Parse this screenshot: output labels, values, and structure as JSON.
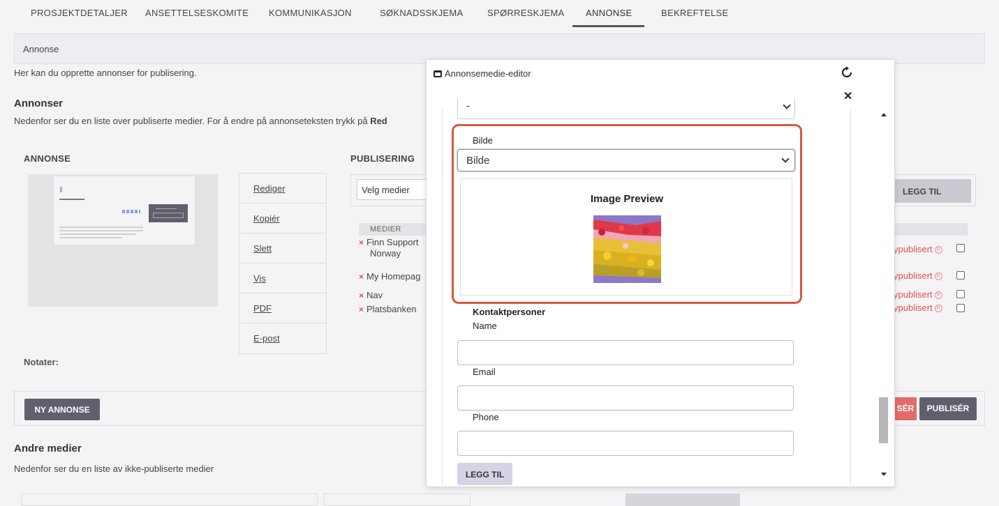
{
  "tabs": [
    {
      "label": "PROSJEKTDETALJER"
    },
    {
      "label": "ANSETTELSESKOMITE"
    },
    {
      "label": "KOMMUNIKASJON"
    },
    {
      "label": "SØKNADSSKJEMA"
    },
    {
      "label": "SPØRRESKJEMA"
    },
    {
      "label": "ANNONSE"
    },
    {
      "label": "BEKREFTELSE"
    }
  ],
  "section": {
    "title": "Annonse",
    "description": "Her kan du opprette annonser for publisering."
  },
  "ads": {
    "heading": "Annonser",
    "description": "Nedenfor ser du en liste over publiserte medier. For å endre på annonseteksten trykk på",
    "description_bold": "Red"
  },
  "annonse_label": "ANNONSE",
  "publisering_label": "PUBLISERING",
  "actions": [
    {
      "label": "Rediger"
    },
    {
      "label": "Kopiér"
    },
    {
      "label": "Slett"
    },
    {
      "label": "Vis"
    },
    {
      "label": "PDF"
    },
    {
      "label": "E-post"
    }
  ],
  "media_select": {
    "placeholder": "Velg medier"
  },
  "add_button_bg": "LEGG TIL",
  "medier_header": "MEDIER",
  "medier": [
    {
      "name": "Finn Support",
      "name2": "Norway"
    },
    {
      "name": "My Homepag",
      "name2": ""
    },
    {
      "name": "Nav",
      "name2": ""
    },
    {
      "name": "Platsbanken",
      "name2": ""
    }
  ],
  "publish_status": "ypublisert",
  "notes_label": "Notater:",
  "new_ad_button": "NY ANNONSE",
  "unpublish_button": "SÉR",
  "publish_button": "PUBLISÉR",
  "other_media": {
    "heading": "Andre medier",
    "description": "Nedenfor ser du en liste av ikke-publiserte medier"
  },
  "modal": {
    "title": "Annonsemedie-editor",
    "top_select_value": "-",
    "image_label": "Bilde",
    "image_select_value": "Bilde",
    "preview_title": "Image Preview",
    "contacts_heading": "Kontaktpersoner",
    "fields": [
      {
        "label": "Name",
        "value": ""
      },
      {
        "label": "Email",
        "value": ""
      },
      {
        "label": "Phone",
        "value": ""
      }
    ],
    "add_button": "LEGG TIL"
  },
  "colors": {
    "highlight": "#d9573f",
    "danger": "#e05050",
    "dark_button": "#5f5f6d"
  }
}
